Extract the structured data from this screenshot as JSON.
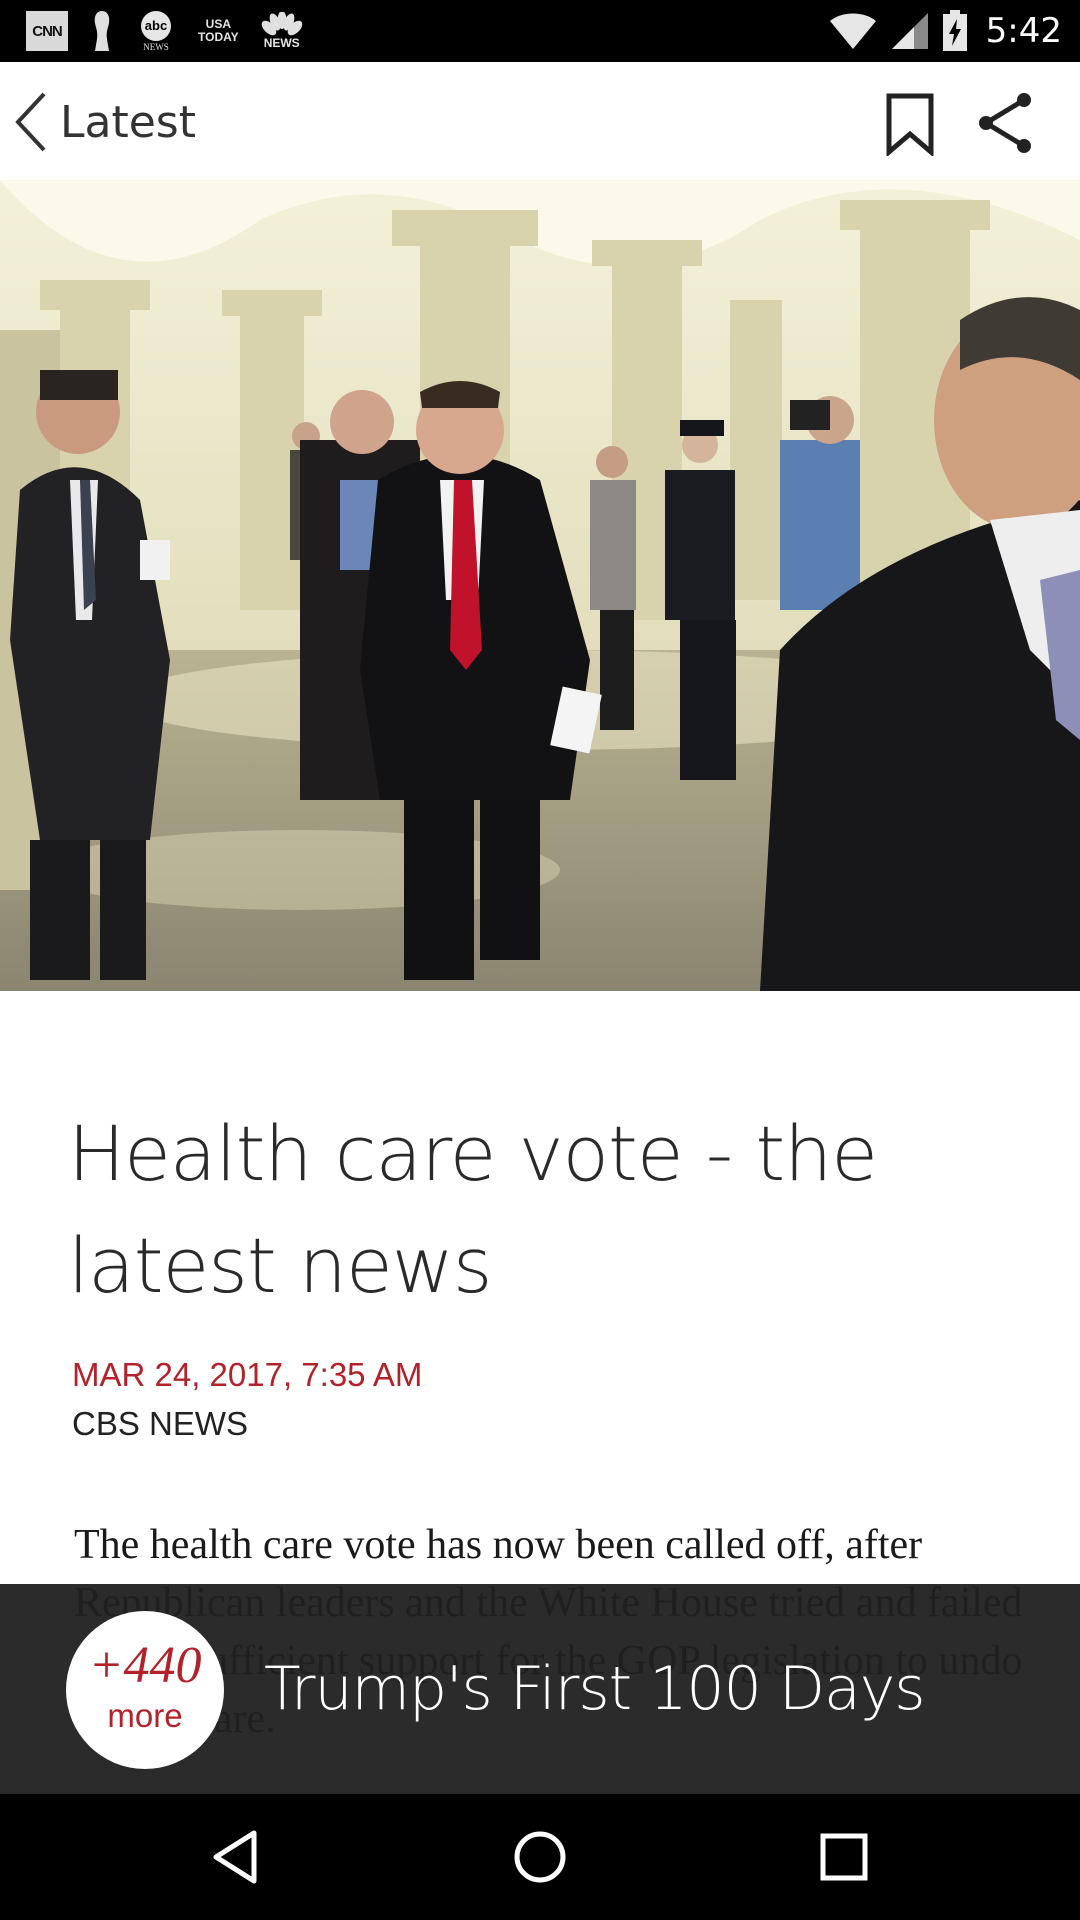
{
  "status_bar": {
    "time": "5:42",
    "notifications": [
      {
        "icon": "cnn-icon",
        "text": "CNN"
      },
      {
        "icon": "abc-news-icon",
        "text": "abc",
        "sub": "NEWS"
      },
      {
        "icon": "usa-today-icon",
        "line1": "USA",
        "line2": "TODAY"
      },
      {
        "icon": "nbc-news-icon",
        "sub": "NEWS"
      }
    ],
    "indicators": [
      "wifi-icon",
      "cellular-signal-icon",
      "battery-charging-icon"
    ]
  },
  "app_bar": {
    "back_label": "Latest",
    "actions": [
      "bookmark-icon",
      "share-icon"
    ]
  },
  "article": {
    "headline": "Health care vote - the latest news",
    "date": "MAR 24, 2017, 7:35 AM",
    "source": "CBS NEWS",
    "body": "The health care vote has now been called off, after Republican leaders and the White House tried and failed to win sufficient support for the GOP legislation to undo Obamacare."
  },
  "more_banner": {
    "count": "+440",
    "more_label": "more",
    "collection_title": "Trump's First 100 Days"
  },
  "colors": {
    "accent": "#b3222a",
    "banner_bg": "#202020",
    "status_bar_bg": "#000000"
  },
  "nav_bar": {
    "buttons": [
      "back-triangle-icon",
      "home-circle-icon",
      "recents-square-icon"
    ]
  }
}
